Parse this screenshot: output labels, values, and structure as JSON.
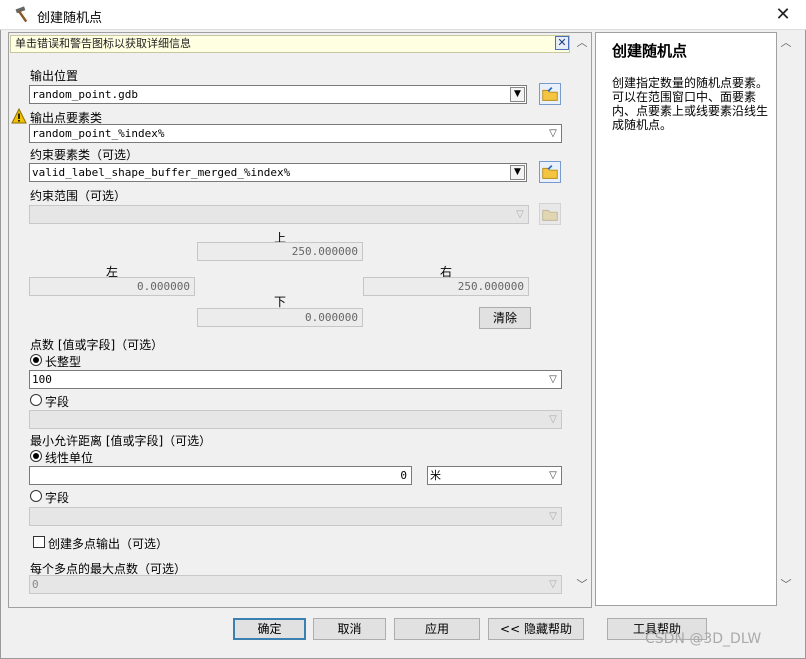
{
  "window": {
    "title": "创建随机点",
    "close_label": "✕"
  },
  "hint": {
    "text": "单击错误和警告图标以获取详细信息",
    "close_label": "✕"
  },
  "output_location": {
    "label": "输出位置",
    "value": "random_point.gdb"
  },
  "output_features": {
    "label": "输出点要素类",
    "value": "random_point_%index%"
  },
  "constraint_features": {
    "label": "约束要素类（可选）",
    "value": "valid_label_shape_buffer_merged_%index%"
  },
  "constraint_extent": {
    "label": "约束范围（可选）",
    "value": "",
    "top_label": "上",
    "top_value": "250.000000",
    "left_label": "左",
    "left_value": "0.000000",
    "right_label": "右",
    "right_value": "250.000000",
    "bottom_label": "下",
    "bottom_value": "0.000000",
    "clear_label": "清除"
  },
  "point_count": {
    "label": "点数 [值或字段]（可选）",
    "long_label": "长整型",
    "long_value": "100",
    "field_label": "字段",
    "field_value": ""
  },
  "min_distance": {
    "label": "最小允许距离 [值或字段]（可选）",
    "linear_label": "线性单位",
    "linear_value": "0",
    "unit_value": "米",
    "field_label": "字段",
    "field_value": ""
  },
  "multipoint": {
    "label": "创建多点输出（可选）",
    "checked": false
  },
  "max_points": {
    "label": "每个多点的最大点数（可选）",
    "value": "0"
  },
  "buttons": {
    "ok": "确定",
    "cancel": "取消",
    "apply": "应用",
    "hide_help": "<< 隐藏帮助",
    "tool_help": "工具帮助"
  },
  "help": {
    "title": "创建随机点",
    "body": "创建指定数量的随机点要素。可以在范围窗口中、面要素内、点要素上或线要素沿线生成随机点。"
  },
  "watermark": "CSDN @3D_DLW",
  "colors": {
    "hint_bg": "#ffffe1",
    "default_border": "#3c7fb1",
    "warning": "#f2c200"
  }
}
